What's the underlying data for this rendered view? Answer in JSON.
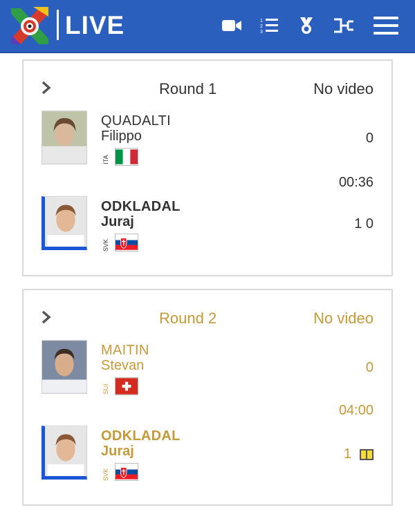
{
  "header": {
    "title": "LIVE",
    "icons": [
      "video-camera-icon",
      "ranked-list-icon",
      "medal-icon",
      "bracket-icon",
      "hamburger-menu-icon"
    ]
  },
  "colors": {
    "header_bg": "#2b5fbe",
    "blue_athlete": "#1a56d6",
    "gold_text": "#c49a3a",
    "card_border": "#d9d9d9"
  },
  "contests": [
    {
      "round": "Round 1",
      "video": "No video",
      "white": {
        "surname": "QUADALTI",
        "firstname": "Filippo",
        "country": "ITA",
        "score": "0"
      },
      "time": "00:36",
      "blue": {
        "surname": "ODKLADAL",
        "firstname": "Juraj",
        "country": "SVK",
        "score": "1 0"
      }
    },
    {
      "round": "Round 2",
      "video": "No video",
      "white": {
        "surname": "MAITIN",
        "firstname": "Stevan",
        "country": "SUI",
        "score": "0"
      },
      "time": "04:00",
      "blue": {
        "surname": "ODKLADAL",
        "firstname": "Juraj",
        "country": "SVK",
        "score": "1",
        "penalty_cards": 1
      }
    }
  ]
}
